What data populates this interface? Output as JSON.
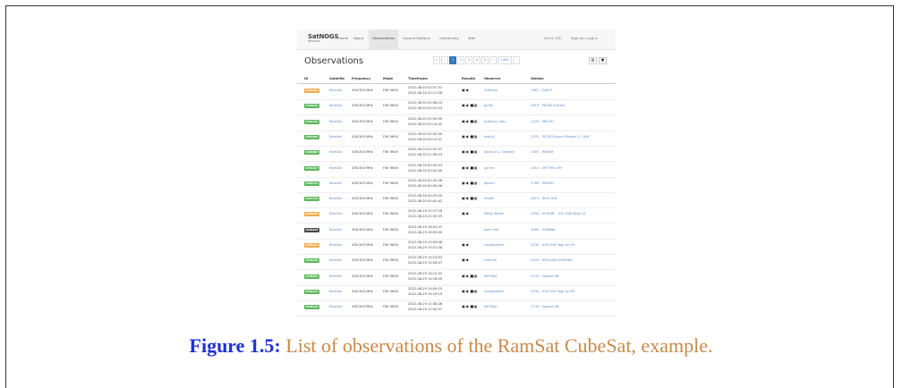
{
  "navbar": {
    "logo_line1": "SatNOGS",
    "logo_line2": "NETWORK",
    "items": [
      "Home",
      "About",
      "Observations",
      "Ground Stations",
      "Community",
      "Wiki"
    ],
    "active_index": 2,
    "time": "04:31 UTC",
    "signin": "Sign Up / Log In"
  },
  "page": {
    "title": "Observations",
    "pager": [
      "«",
      "‹",
      "1",
      "2",
      "3",
      "4",
      "5",
      "...",
      "1350",
      "›"
    ],
    "pager_active_index": 2,
    "tools": [
      "⚙",
      "▼"
    ]
  },
  "table": {
    "headers": [
      "ID",
      "Satellite",
      "Frequency",
      "Mode",
      "Timeframe",
      "Results",
      "Observer",
      "Station"
    ],
    "rows": [
      {
        "status": "orange",
        "id": "6461284",
        "sat": "RamSat",
        "freq": "436.300 MHz",
        "mode": "FSK 9600",
        "t1": "2022-08-30 02:07:31",
        "t2": "2022-08-30 02:12:58",
        "res": "▣◀",
        "obs": "Anthony",
        "station": "1367 - F4KLP"
      },
      {
        "status": "green",
        "id": "6459916",
        "sat": "RamSat",
        "freq": "436.300 MHz",
        "mode": "FSK 9600",
        "t1": "2022-08-30 02:06:10",
        "t2": "2022-08-30 02:15:23",
        "res": "▣◀ ■▦",
        "obs": "pi2bs",
        "station": "1619 - PE2BS Ermelo"
      },
      {
        "status": "green",
        "id": "6461764",
        "sat": "RamSat",
        "freq": "436.300 MHz",
        "mode": "FSK 9600",
        "t1": "2022-08-30 02:05:09",
        "t2": "2022-08-30 02:14:42",
        "res": "▣◀ ■▦",
        "obs": "Anthony Vasz",
        "station": "2129 - 5BOGU"
      },
      {
        "status": "green",
        "id": "6461650",
        "sat": "RamSat",
        "freq": "436.300 MHz",
        "mode": "FSK 9600",
        "t1": "2022-08-30 02:05:00",
        "t2": "2022-08-30 02:14:47",
        "res": "▣◀ ■▦",
        "obs": "mtb3n",
        "station": "2155 - PE2JD Ground Station 2 - UHF"
      },
      {
        "status": "green",
        "id": "6460898",
        "sat": "RamSat",
        "freq": "436.300 MHz",
        "mode": "FSK 9600",
        "t1": "2022-08-30 01:02:37",
        "t2": "2022-08-30 01:09:23",
        "res": "▣◀ ■▦",
        "obs": "Jacob D.C. Silvaste",
        "station": "1587 - 9S8XM"
      },
      {
        "status": "green",
        "id": "6459227",
        "sat": "RamSat",
        "freq": "436.300 MHz",
        "mode": "FSK 9600",
        "t1": "2022-08-30 00:35:53",
        "t2": "2022-08-30 00:42:00",
        "res": "▣◀ ■▦",
        "obs": "sp7mr",
        "station": "2012 - SP7THR-UHF"
      },
      {
        "status": "green",
        "id": "6458722",
        "sat": "RamSat",
        "freq": "436.300 MHz",
        "mode": "FSK 9600",
        "t1": "2022-08-30 00:35:28",
        "t2": "2022-08-30 00:39:26",
        "res": "▣◀ ■▦",
        "obs": "jbeach",
        "station": "2789 - PA9SEC"
      },
      {
        "status": "green",
        "id": "6461716",
        "sat": "RamSat",
        "freq": "436.300 MHz",
        "mode": "FSK 9600",
        "t1": "2022-08-30 00:33:00",
        "t2": "2022-08-30 00:42:42",
        "res": "▣◀ ■▦",
        "obs": "kissek",
        "station": "2415 - RIVO UHF"
      },
      {
        "status": "orange",
        "id": "6455839",
        "sat": "RamSat",
        "freq": "436.300 MHz",
        "mode": "FSK 9600",
        "t1": "2022-08-29 21:27:18",
        "t2": "2022-08-29 21:30:29",
        "res": "▣◀",
        "obs": "Pekon Betas",
        "station": "1994 - SV9QBF - 4TL-SQM Blog v3"
      },
      {
        "status": "dark",
        "id": "6460105",
        "sat": "RamSat",
        "freq": "436.300 MHz",
        "mode": "FSK 9600",
        "t1": "2022-08-29 18:04:21",
        "t2": "2022-08-29 18:09:50",
        "res": "",
        "obs": "koen kalt",
        "station": "2069 - ZS6NNA"
      },
      {
        "status": "orange",
        "id": "6459122",
        "sat": "RamSat",
        "freq": "436.300 MHz",
        "mode": "FSK 9600",
        "t1": "2022-08-29 15:45:06",
        "t2": "2022-08-29 15:51:28",
        "res": "▣◀",
        "obs": "usugestaem",
        "station": "2030 - USU GAS Yagi Az+El"
      },
      {
        "status": "green",
        "id": "6459108",
        "sat": "RamSat",
        "freq": "436.300 MHz",
        "mode": "FSK 9600",
        "t1": "2022-08-29 15:23:53",
        "t2": "2022-08-29 15:28:07",
        "res": "▣◀",
        "obs": "rmarnik",
        "station": "2159 - IT0OLAB SV9NDRA"
      },
      {
        "status": "green",
        "id": "6458662",
        "sat": "RamSat",
        "freq": "436.300 MHz",
        "mode": "FSK 9600",
        "t1": "2022-08-29 14:12:52",
        "t2": "2022-08-29 14:18:00",
        "res": "▣◀ ■▦",
        "obs": "Jeff Moe",
        "station": "2733 - spacecruft"
      },
      {
        "status": "green",
        "id": "6459123",
        "sat": "RamSat",
        "freq": "436.300 MHz",
        "mode": "FSK 9600",
        "t1": "2022-08-29 14:09:25",
        "t2": "2022-08-29 14:19:10",
        "res": "▣◀ ■▦",
        "obs": "usugestaem",
        "station": "2030 - USU GAS Yagi Az+El"
      },
      {
        "status": "green",
        "id": "6458120",
        "sat": "RamSat",
        "freq": "436.300 MHz",
        "mode": "FSK 9600",
        "t1": "2022-08-29 12:38:28",
        "t2": "2022-08-29 12:42:57",
        "res": "▣◀ ■▦",
        "obs": "Jeff Moe",
        "station": "2733 - spacecruft"
      },
      {
        "status": "green",
        "id": "6458001",
        "sat": "RamSat",
        "freq": "436.300 MHz",
        "mode": "FSK 9600",
        "t1": "2022-08-29 12:01:10",
        "t2": "2022-08-29 12:09:44",
        "res": "▣◀ ■▦",
        "obs": "Jeff Moe",
        "station": "2733 - spacecruft"
      }
    ]
  },
  "colors": {
    "green": "#5cb85c",
    "orange": "#f0ad4e",
    "dark": "#4a4a4a",
    "link": "#5b8ac4",
    "primary": "#337ab7"
  },
  "caption": {
    "label": "Figure 1.5:",
    "text": "List of observations of the RamSat CubeSat, example."
  }
}
